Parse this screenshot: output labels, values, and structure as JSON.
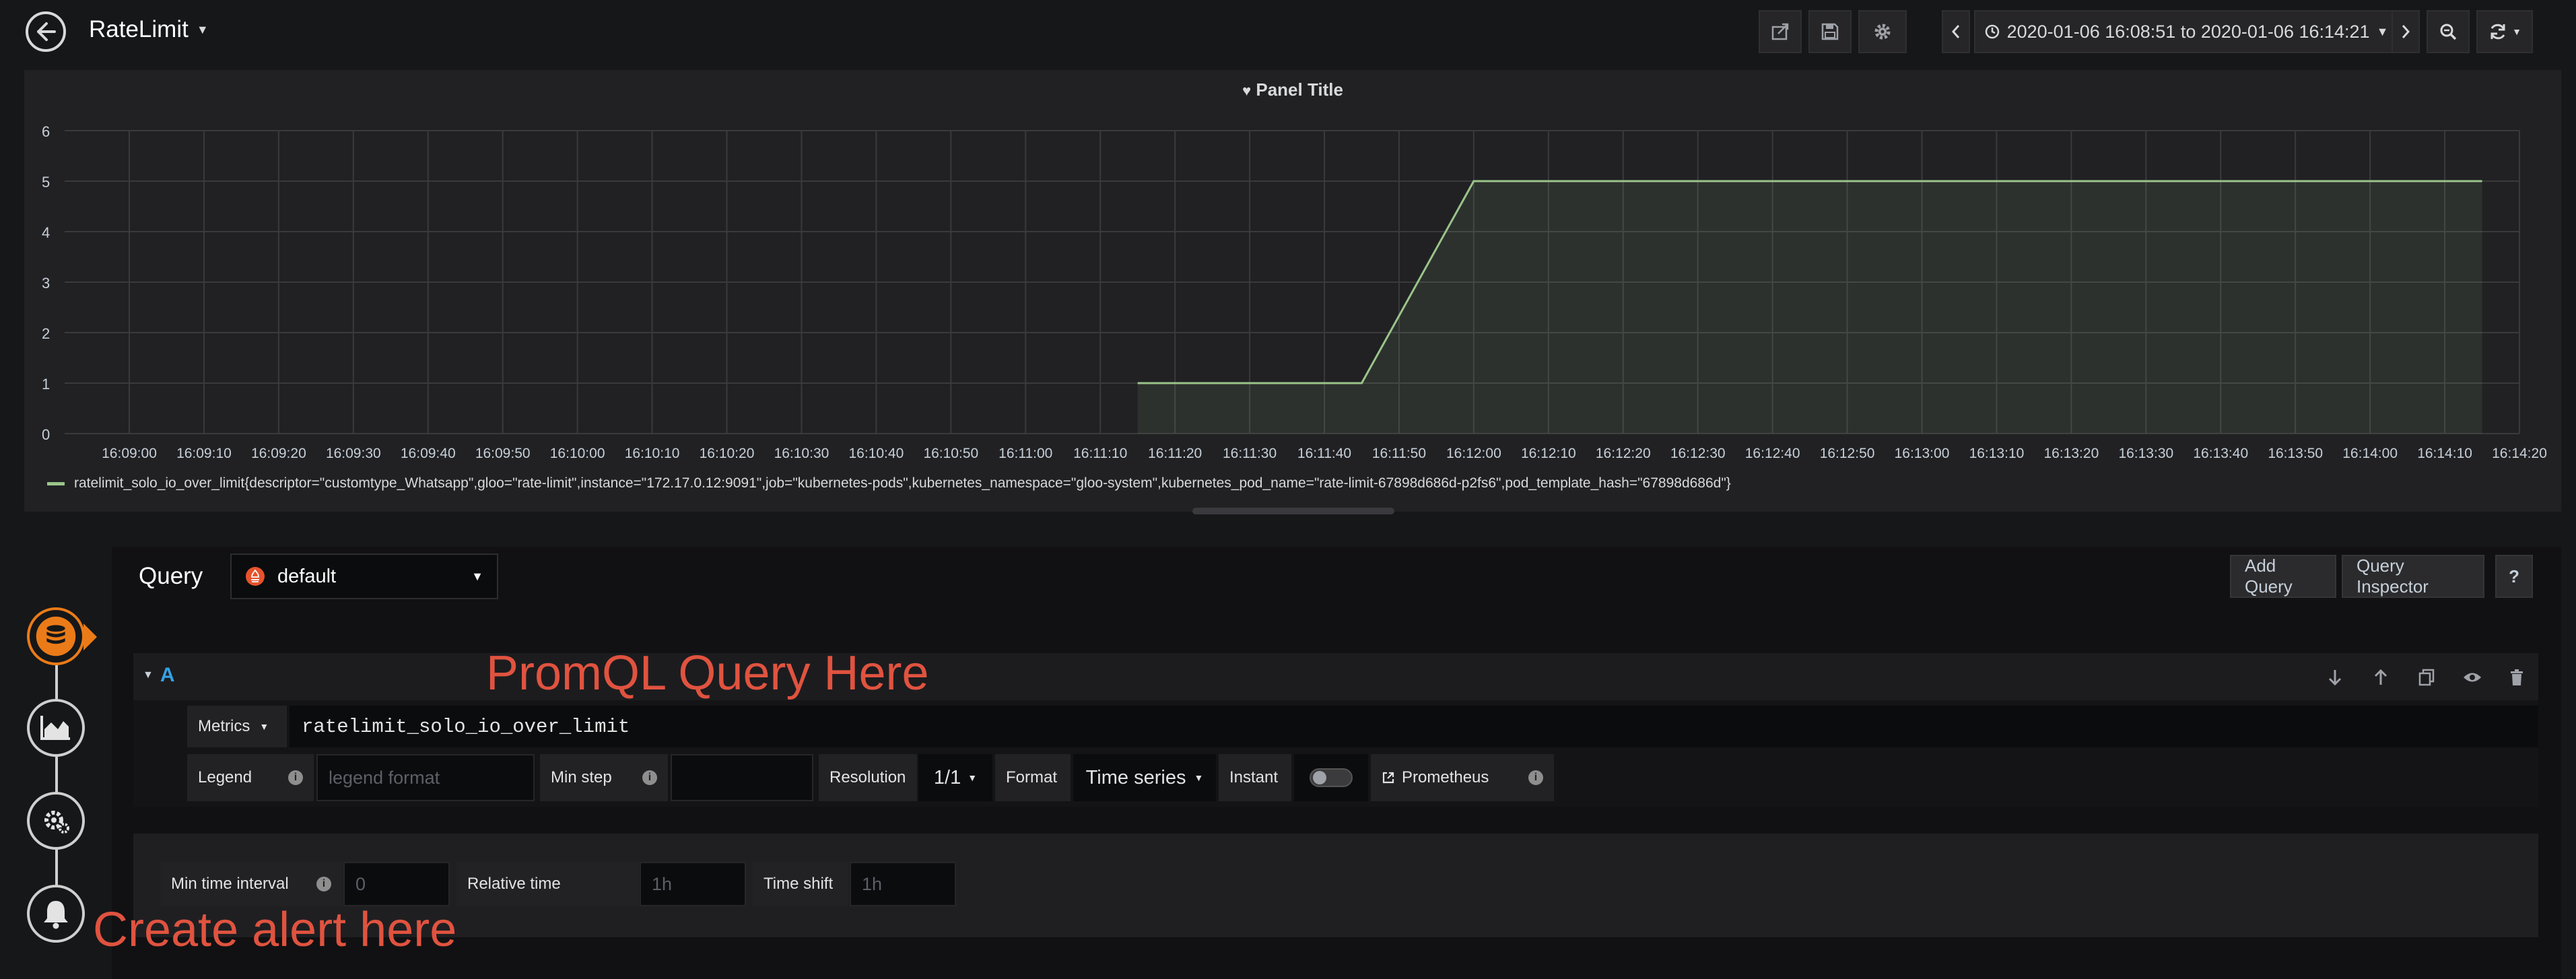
{
  "header": {
    "title": "RateLimit",
    "time_range": "2020-01-06 16:08:51 to 2020-01-06 16:14:21"
  },
  "panel": {
    "title": "Panel Title",
    "legend": "ratelimit_solo_io_over_limit{descriptor=\"customtype_Whatsapp\",gloo=\"rate-limit\",instance=\"172.17.0.12:9091\",job=\"kubernetes-pods\",kubernetes_namespace=\"gloo-system\",kubernetes_pod_name=\"rate-limit-67898d686d-p2fs6\",pod_template_hash=\"67898d686d\"}"
  },
  "chart_data": {
    "type": "line",
    "title": "Panel Title",
    "x_ticks": [
      "16:09:00",
      "16:09:10",
      "16:09:20",
      "16:09:30",
      "16:09:40",
      "16:09:50",
      "16:10:00",
      "16:10:10",
      "16:10:20",
      "16:10:30",
      "16:10:40",
      "16:10:50",
      "16:11:00",
      "16:11:10",
      "16:11:20",
      "16:11:30",
      "16:11:40",
      "16:11:50",
      "16:12:00",
      "16:12:10",
      "16:12:20",
      "16:12:30",
      "16:12:40",
      "16:12:50",
      "16:13:00",
      "16:13:10",
      "16:13:20",
      "16:13:30",
      "16:13:40",
      "16:13:50",
      "16:14:00",
      "16:14:10",
      "16:14:20"
    ],
    "y_ticks": [
      "0",
      "1",
      "2",
      "3",
      "4",
      "5",
      "6"
    ],
    "ylim": [
      0,
      6
    ],
    "grid": true,
    "legend_position": "bottom-left",
    "series": [
      {
        "name": "ratelimit_solo_io_over_limit",
        "color": "#9ac48a",
        "x": [
          "16:11:15",
          "16:11:45",
          "16:12:00",
          "16:14:15"
        ],
        "y": [
          1,
          1,
          5,
          5
        ]
      }
    ]
  },
  "editor": {
    "query_label": "Query",
    "datasource": "default",
    "add_query": "Add Query",
    "query_inspector": "Query Inspector",
    "help": "?",
    "query_letter": "A",
    "metrics_label": "Metrics",
    "metrics_value": "ratelimit_solo_io_over_limit",
    "legend_label": "Legend",
    "legend_placeholder": "legend format",
    "min_step_label": "Min step",
    "resolution_label": "Resolution",
    "resolution_value": "1/1",
    "format_label": "Format",
    "format_value": "Time series",
    "instant_label": "Instant",
    "prometheus_link": "Prometheus",
    "min_time_interval_label": "Min time interval",
    "min_time_interval_placeholder": "0",
    "relative_time_label": "Relative time",
    "relative_time_placeholder": "1h",
    "time_shift_label": "Time shift",
    "time_shift_placeholder": "1h"
  },
  "annotations": {
    "promql": "PromQL Query Here",
    "alert": "Create alert here"
  },
  "colors": {
    "accent": "#eb7b18",
    "series": "#9ac48a",
    "annotation": "#e0533f",
    "query_letter": "#33a2e5"
  }
}
